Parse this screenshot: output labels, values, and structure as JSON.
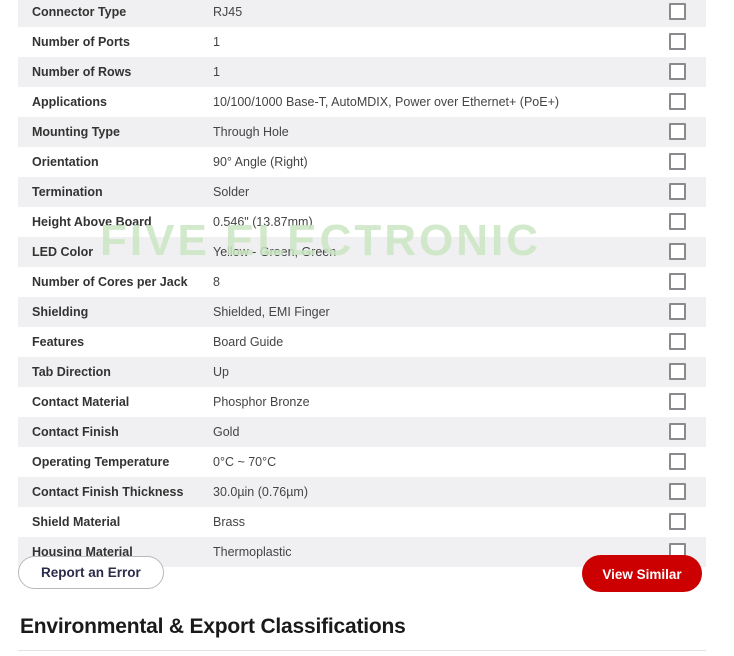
{
  "watermark": {
    "text": "FIVE ELECTRONIC"
  },
  "spec_table": {
    "checkbox_icon": "checkbox-unchecked-icon",
    "rows": [
      {
        "label": "Connector Type",
        "value": "RJ45",
        "shaded": true
      },
      {
        "label": "Number of Ports",
        "value": "1",
        "shaded": false
      },
      {
        "label": "Number of Rows",
        "value": "1",
        "shaded": true
      },
      {
        "label": "Applications",
        "value": "10/100/1000 Base-T, AutoMDIX, Power over Ethernet+ (PoE+)",
        "shaded": false
      },
      {
        "label": "Mounting Type",
        "value": "Through Hole",
        "shaded": true
      },
      {
        "label": "Orientation",
        "value": "90° Angle (Right)",
        "shaded": false
      },
      {
        "label": "Termination",
        "value": "Solder",
        "shaded": true
      },
      {
        "label": "Height Above Board",
        "value": "0.546\" (13.87mm)",
        "shaded": false
      },
      {
        "label": "LED Color",
        "value": "Yellow - Green, Green",
        "shaded": true
      },
      {
        "label": "Number of Cores per Jack",
        "value": "8",
        "shaded": false
      },
      {
        "label": "Shielding",
        "value": "Shielded, EMI Finger",
        "shaded": true
      },
      {
        "label": "Features",
        "value": "Board Guide",
        "shaded": false
      },
      {
        "label": "Tab Direction",
        "value": "Up",
        "shaded": true
      },
      {
        "label": "Contact Material",
        "value": "Phosphor Bronze",
        "shaded": false
      },
      {
        "label": "Contact Finish",
        "value": "Gold",
        "shaded": true
      },
      {
        "label": "Operating Temperature",
        "value": "0°C ~ 70°C",
        "shaded": false
      },
      {
        "label": "Contact Finish Thickness",
        "value": "30.0µin (0.76µm)",
        "shaded": true
      },
      {
        "label": "Shield Material",
        "value": "Brass",
        "shaded": false
      },
      {
        "label": "Housing Material",
        "value": "Thermoplastic",
        "shaded": true
      }
    ]
  },
  "actions": {
    "report_error_label": "Report an Error",
    "view_similar_label": "View Similar",
    "view_similar_color": "#cc0000"
  },
  "section": {
    "heading": "Environmental & Export Classifications"
  }
}
